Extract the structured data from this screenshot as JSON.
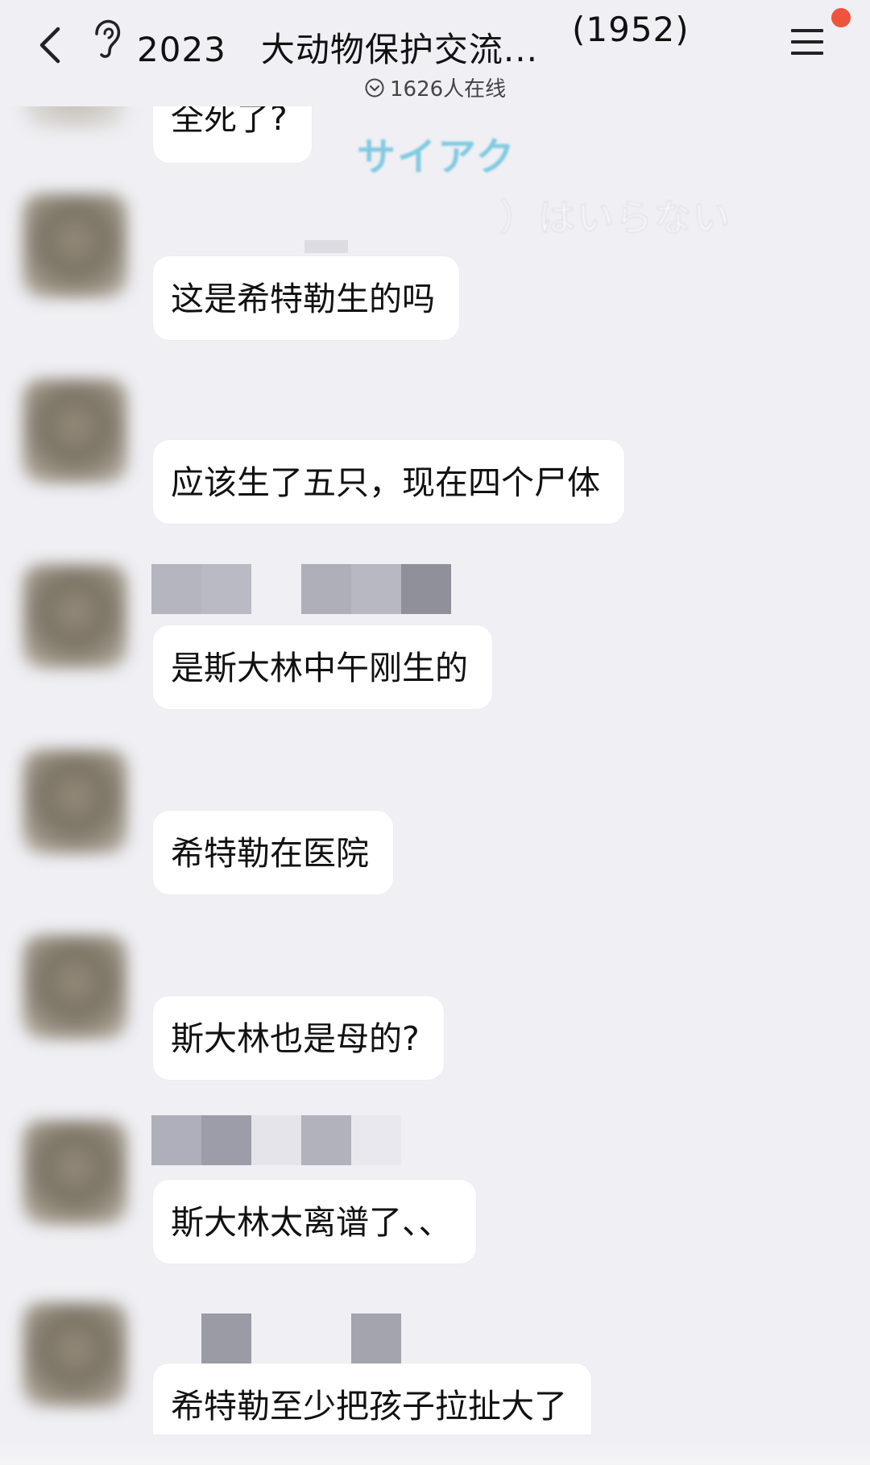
{
  "header": {
    "title": "2023　大动物保护交流...",
    "member_count": "(1952)",
    "online_text": "1626人在线",
    "notification_color": "#f0533c"
  },
  "watermarks": {
    "katakana": "サイアク",
    "hiragana": "）はいらない"
  },
  "messages": [
    {
      "text": "全死了?"
    },
    {
      "text": "这是希特勒生的吗"
    },
    {
      "text": "应该生了五只，现在四个尸体"
    },
    {
      "text": "是斯大林中午刚生的"
    },
    {
      "text": "希特勒在医院"
    },
    {
      "text": "斯大林也是母的?"
    },
    {
      "text": "斯大林太离谱了、、"
    },
    {
      "text": "希特勒至少把孩子拉扯大了"
    }
  ],
  "icons": {
    "back": "chevron-left-icon",
    "ear": "ear-icon",
    "online": "check-circle-icon",
    "menu": "hamburger-menu-icon"
  },
  "colors": {
    "background": "#efeff4",
    "bubble": "#ffffff",
    "watermark_katakana": "#6ec4de"
  }
}
